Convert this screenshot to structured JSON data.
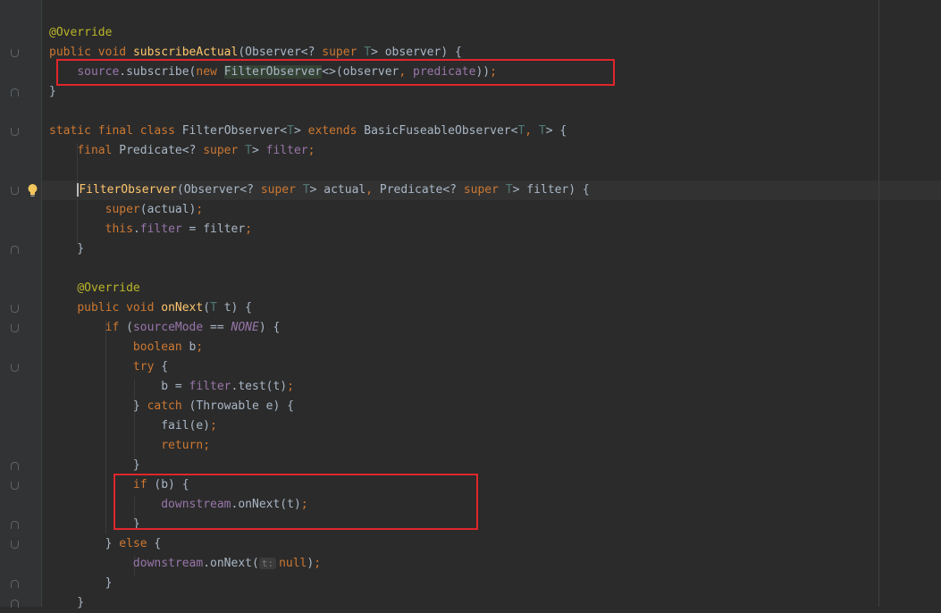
{
  "editor": {
    "lines": [
      [
        {
          "t": "@Override",
          "c": "ann"
        }
      ],
      [
        {
          "t": "public ",
          "c": "kw"
        },
        {
          "t": "void ",
          "c": "kw"
        },
        {
          "t": "subscribeActual",
          "c": "fn"
        },
        {
          "t": "(Observer<? "
        },
        {
          "t": "super ",
          "c": "kw"
        },
        {
          "t": "T",
          "c": "tp"
        },
        {
          "t": "> observer) {"
        }
      ],
      [
        {
          "t": "    "
        },
        {
          "t": "source",
          "c": "fld"
        },
        {
          "t": ".subscribe("
        },
        {
          "t": "new ",
          "c": "kw"
        },
        {
          "t": "FilterObserver",
          "c": "hl"
        },
        {
          "t": "<>(observer"
        },
        {
          "t": ", ",
          "c": "kw"
        },
        {
          "t": "predicate",
          "c": "fld"
        },
        {
          "t": "))"
        },
        {
          "t": ";",
          "c": "kw"
        }
      ],
      [
        {
          "t": "}"
        }
      ],
      [],
      [
        {
          "t": "static ",
          "c": "kw"
        },
        {
          "t": "final ",
          "c": "kw"
        },
        {
          "t": "class ",
          "c": "kw"
        },
        {
          "t": "FilterObserver<"
        },
        {
          "t": "T",
          "c": "tp"
        },
        {
          "t": "> "
        },
        {
          "t": "extends ",
          "c": "kw"
        },
        {
          "t": "BasicFuseableObserver<"
        },
        {
          "t": "T",
          "c": "tp"
        },
        {
          "t": ", ",
          "c": "kw"
        },
        {
          "t": "T",
          "c": "tp"
        },
        {
          "t": "> {"
        }
      ],
      [
        {
          "t": "    "
        },
        {
          "t": "final ",
          "c": "kw"
        },
        {
          "t": "Predicate<? "
        },
        {
          "t": "super ",
          "c": "kw"
        },
        {
          "t": "T",
          "c": "tp"
        },
        {
          "t": "> "
        },
        {
          "t": "filter",
          "c": "fld"
        },
        {
          "t": ";",
          "c": "kw"
        }
      ],
      [],
      [
        {
          "t": "    "
        },
        {
          "t": "FilterObserver",
          "c": "fn cur"
        },
        {
          "t": "(Observer<? "
        },
        {
          "t": "super ",
          "c": "kw"
        },
        {
          "t": "T",
          "c": "tp"
        },
        {
          "t": "> actual"
        },
        {
          "t": ", ",
          "c": "kw"
        },
        {
          "t": "Predicate<? "
        },
        {
          "t": "super ",
          "c": "kw"
        },
        {
          "t": "T",
          "c": "tp"
        },
        {
          "t": "> filter) {"
        }
      ],
      [
        {
          "t": "        "
        },
        {
          "t": "super",
          "c": "kw"
        },
        {
          "t": "(actual)"
        },
        {
          "t": ";",
          "c": "kw"
        }
      ],
      [
        {
          "t": "        "
        },
        {
          "t": "this",
          "c": "kw"
        },
        {
          "t": "."
        },
        {
          "t": "filter",
          "c": "fld"
        },
        {
          "t": " = filter"
        },
        {
          "t": ";",
          "c": "kw"
        }
      ],
      [
        {
          "t": "    }"
        }
      ],
      [],
      [
        {
          "t": "    "
        },
        {
          "t": "@Override",
          "c": "ann"
        }
      ],
      [
        {
          "t": "    "
        },
        {
          "t": "public ",
          "c": "kw"
        },
        {
          "t": "void ",
          "c": "kw"
        },
        {
          "t": "onNext",
          "c": "fn"
        },
        {
          "t": "("
        },
        {
          "t": "T",
          "c": "tp"
        },
        {
          "t": " t) {"
        }
      ],
      [
        {
          "t": "        "
        },
        {
          "t": "if ",
          "c": "kw"
        },
        {
          "t": "("
        },
        {
          "t": "sourceMode",
          "c": "fld"
        },
        {
          "t": " == "
        },
        {
          "t": "NONE",
          "c": "it"
        },
        {
          "t": ") {"
        }
      ],
      [
        {
          "t": "            "
        },
        {
          "t": "boolean ",
          "c": "kw"
        },
        {
          "t": "b"
        },
        {
          "t": ";",
          "c": "kw"
        }
      ],
      [
        {
          "t": "            "
        },
        {
          "t": "try ",
          "c": "kw"
        },
        {
          "t": "{"
        }
      ],
      [
        {
          "t": "                b = "
        },
        {
          "t": "filter",
          "c": "fld"
        },
        {
          "t": ".test(t)"
        },
        {
          "t": ";",
          "c": "kw"
        }
      ],
      [
        {
          "t": "            } "
        },
        {
          "t": "catch ",
          "c": "kw"
        },
        {
          "t": "(Throwable e) {"
        }
      ],
      [
        {
          "t": "                fail(e)"
        },
        {
          "t": ";",
          "c": "kw"
        }
      ],
      [
        {
          "t": "                "
        },
        {
          "t": "return;",
          "c": "kw"
        }
      ],
      [
        {
          "t": "            }"
        }
      ],
      [
        {
          "t": "            "
        },
        {
          "t": "if ",
          "c": "kw"
        },
        {
          "t": "(b) {"
        }
      ],
      [
        {
          "t": "                "
        },
        {
          "t": "downstream",
          "c": "fld"
        },
        {
          "t": ".onNext(t)"
        },
        {
          "t": ";",
          "c": "kw"
        }
      ],
      [
        {
          "t": "            }"
        }
      ],
      [
        {
          "t": "        } "
        },
        {
          "t": "else ",
          "c": "kw"
        },
        {
          "t": "{"
        }
      ],
      [
        {
          "t": "            "
        },
        {
          "t": "downstream",
          "c": "fld"
        },
        {
          "t": ".onNext("
        },
        {
          "t": "t:",
          "c": "hint"
        },
        {
          "t": "null",
          "c": "kw"
        },
        {
          "t": ")"
        },
        {
          "t": ";",
          "c": "kw"
        }
      ],
      [
        {
          "t": "        }"
        }
      ],
      [
        {
          "t": "    }"
        }
      ]
    ]
  },
  "icons": {
    "intention": "lightbulb-icon",
    "fold": "fold-marker-icon"
  },
  "colors": {
    "background": "#2b2b2b",
    "keyword": "#cc7832",
    "annotation": "#bbb529",
    "method": "#ffc66d",
    "field": "#9876aa",
    "type_param": "#507874",
    "highlight_box": "#e0262b"
  }
}
